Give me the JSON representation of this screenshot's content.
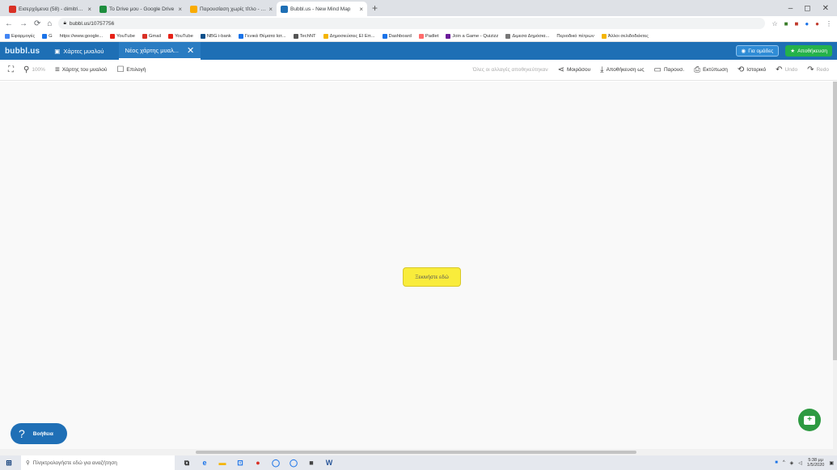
{
  "browser": {
    "tabs": [
      {
        "title": "Εισερχόμενα (58) - dimitris.deli@...",
        "favicon_color": "#d93025"
      },
      {
        "title": "Το Drive μου - Google Drive",
        "favicon_color": "#1e8e3e"
      },
      {
        "title": "Παρουσίαση χωρίς τίτλο - Παρ...",
        "favicon_color": "#f9ab00"
      },
      {
        "title": "Bubbl.us - New Mind Map",
        "favicon_color": "#1e6fb5",
        "active": true
      }
    ],
    "new_tab": "+",
    "window_controls": [
      "–",
      "◻",
      "✕"
    ],
    "url": "bubbl.us/10757756",
    "bookmarks": [
      "Εφαρμογές",
      "G",
      "https://www.google...",
      "YouTube",
      "Gmail",
      "YouTube",
      "NBG i-bank",
      "Γενικά Θέματα Ιατ...",
      "TechNT",
      "Δημοσιεύσεις ΕΙ Επ...",
      "Dashboard",
      "Padlet",
      "Join a Game - Quizizz",
      "Διμεσα Δημόσια...",
      "Περιοδικό πέτρων",
      "Άλλοι σελιδοδείκτες"
    ]
  },
  "app": {
    "logo": "bubbl.us",
    "maps_tab": "Χάρτες μυαλού",
    "current_tab": "Νέος χάρτης μυαλ...",
    "login_label": "Για ομάδες",
    "save_label": "Αποθήκευση"
  },
  "toolbar": {
    "zoom": "100%",
    "maps_label": "Χάρτης του μυαλού",
    "select_label": "Επιλογή",
    "status_text": "Όλες οι αλλαγές αποθηκεύτηκαν",
    "share_label": "Μοιράσου",
    "export_label": "Αποθήκευση ως",
    "present_label": "Παρουσ.",
    "print_label": "Εκτύπωση",
    "history_label": "Ιστορικό",
    "undo_label": "Undo",
    "redo_label": "Redo"
  },
  "canvas": {
    "node_label": "Ξεκινήστε εδώ",
    "node_color": "#f9ec3b"
  },
  "help": {
    "label": "Βοήθεια"
  },
  "taskbar": {
    "search_placeholder": "Πληκτρολογήστε εδώ για αναζήτηση",
    "time": "5:38 μμ",
    "date": "1/5/2020"
  }
}
